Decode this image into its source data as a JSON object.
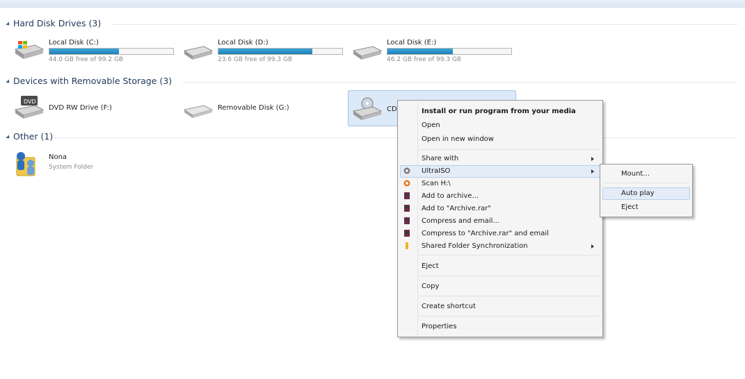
{
  "sections": {
    "hard_disks": "Hard Disk Drives (3)",
    "removable": "Devices with Removable Storage (3)",
    "other": "Other (1)"
  },
  "drives": [
    {
      "name": "Local Disk (C:)",
      "free": "44.0 GB free of 99.2 GB",
      "used_fraction": 0.56,
      "icon": "windows-drive-icon"
    },
    {
      "name": "Local Disk (D:)",
      "free": "23.6 GB free of 99.3 GB",
      "used_fraction": 0.76,
      "icon": "hard-drive-icon"
    },
    {
      "name": "Local Disk (E:)",
      "free": "46.2 GB free of 99.3 GB",
      "used_fraction": 0.53,
      "icon": "hard-drive-icon"
    }
  ],
  "devices": [
    {
      "name": "DVD RW Drive (F:)",
      "icon": "dvd-drive-icon"
    },
    {
      "name": "Removable Disk (G:)",
      "icon": "removable-disk-icon"
    },
    {
      "name": "CD",
      "icon": "cd-drive-icon"
    }
  ],
  "other": {
    "name": "Nona",
    "type": "System Folder",
    "icon": "user-folder-icon"
  },
  "context_menu": {
    "install": "Install or run program from your media",
    "open": "Open",
    "open_new": "Open in new window",
    "share_with": "Share with",
    "ultraiso": "UltraISO",
    "scan": "Scan H:\\",
    "add_archive": "Add to archive...",
    "add_archive_rar": "Add to \"Archive.rar\"",
    "compress_email": "Compress and email...",
    "compress_rar_email": "Compress to \"Archive.rar\" and email",
    "shared_sync": "Shared Folder Synchronization",
    "eject": "Eject",
    "copy": "Copy",
    "create_shortcut": "Create shortcut",
    "properties": "Properties"
  },
  "submenu": {
    "mount": "Mount...",
    "auto_play": "Auto play",
    "eject": "Eject"
  }
}
